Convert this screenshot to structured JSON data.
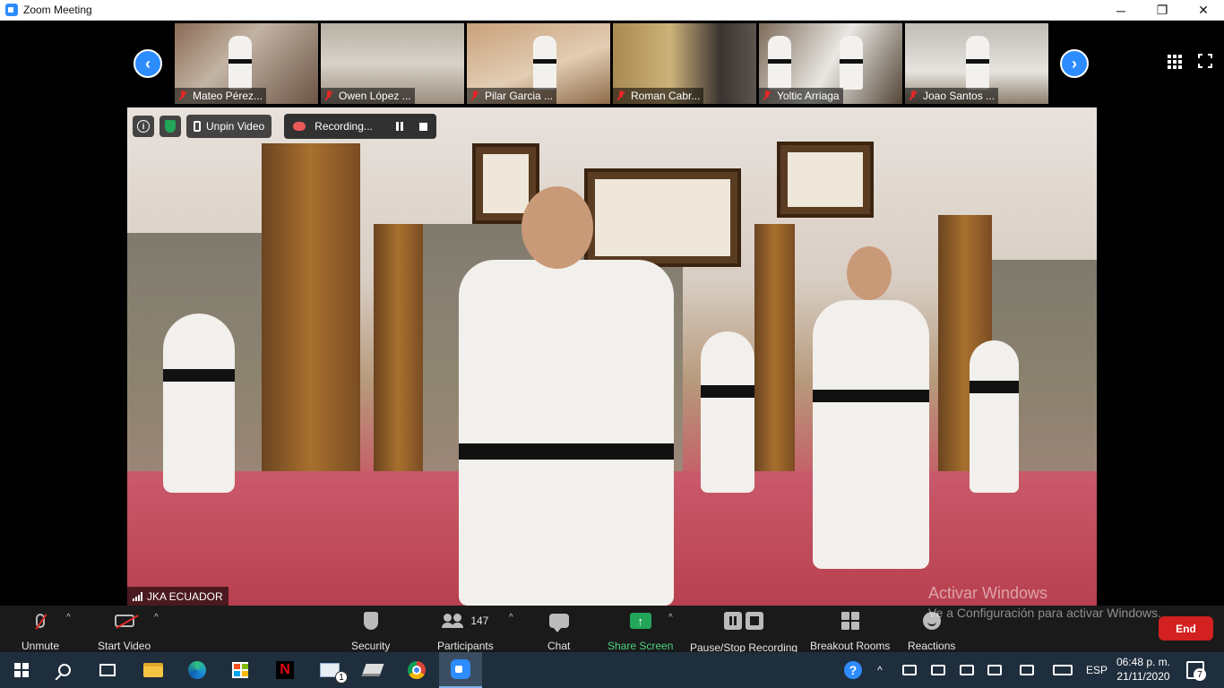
{
  "window": {
    "title": "Zoom Meeting",
    "minimize": "─",
    "restore": "❐",
    "close": "✕"
  },
  "gallery": {
    "prev_arrow": "‹",
    "next_arrow": "›",
    "participants": [
      {
        "name": "Mateo Pérez..."
      },
      {
        "name": "Owen López ..."
      },
      {
        "name": "Pilar Garcia ..."
      },
      {
        "name": "Roman Cabr..."
      },
      {
        "name": "Yoltic Arriaga"
      },
      {
        "name": "Joao Santos ..."
      }
    ]
  },
  "video_toolbar": {
    "info": "i",
    "unpin_label": "Unpin Video",
    "recording_label": "Recording..."
  },
  "main_video": {
    "name": "JKA ECUADOR"
  },
  "controls": {
    "unmute": "Unmute",
    "start_video": "Start Video",
    "security": "Security",
    "participants": "Participants",
    "participant_count": "147",
    "chat": "Chat",
    "share_screen": "Share Screen",
    "share_arrow": "↑",
    "pause_stop_recording": "Pause/Stop Recording",
    "breakout_rooms": "Breakout Rooms",
    "reactions": "Reactions",
    "end": "End",
    "caret": "^"
  },
  "watermark": {
    "line1": "Activar Windows",
    "line2": "Ve a Configuración para activar Windows."
  },
  "taskbar": {
    "netflix": "N",
    "mail_badge": "1",
    "help": "?",
    "tray_caret": "^",
    "language": "ESP",
    "time": "06:48 p. m.",
    "date": "21/11/2020",
    "notification_count": "7"
  },
  "colors": {
    "zoom_blue": "#2d8cff",
    "end_red": "#d32020",
    "share_green": "#23a55a",
    "muted_red": "#e02828"
  }
}
